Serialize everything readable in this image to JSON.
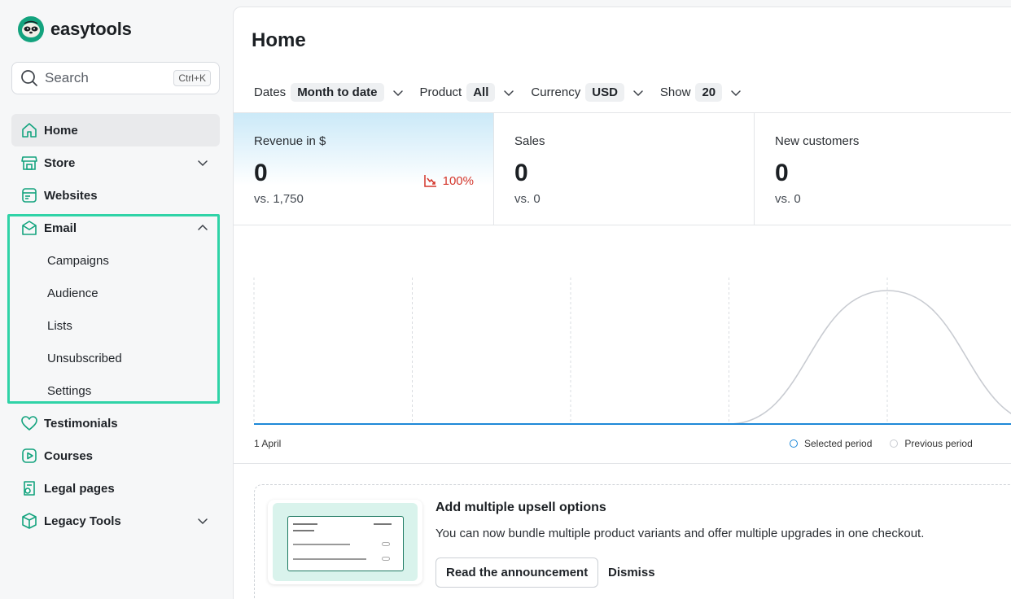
{
  "brand": {
    "name": "easytools",
    "accent": "#13a37e",
    "highlight": "#2fd3a7"
  },
  "search": {
    "placeholder": "Search",
    "shortcut": "Ctrl+K"
  },
  "sidebar": {
    "items": [
      {
        "label": "Home",
        "icon": "home-icon",
        "active": true
      },
      {
        "label": "Store",
        "icon": "store-icon",
        "chevron": "down"
      },
      {
        "label": "Websites",
        "icon": "websites-icon"
      },
      {
        "label": "Email",
        "icon": "email-icon",
        "chevron": "up",
        "expanded": true
      },
      {
        "label": "Testimonials",
        "icon": "heart-icon"
      },
      {
        "label": "Courses",
        "icon": "courses-icon"
      },
      {
        "label": "Legal pages",
        "icon": "legal-icon"
      },
      {
        "label": "Legacy Tools",
        "icon": "box-icon",
        "chevron": "down"
      }
    ],
    "email_subitems": [
      "Campaigns",
      "Audience",
      "Lists",
      "Unsubscribed",
      "Settings"
    ]
  },
  "page": {
    "title": "Home"
  },
  "filters": [
    {
      "label": "Dates",
      "value": "Month to date"
    },
    {
      "label": "Product",
      "value": "All"
    },
    {
      "label": "Currency",
      "value": "USD"
    },
    {
      "label": "Show",
      "value": "20"
    }
  ],
  "stats": [
    {
      "label": "Revenue in $",
      "value": "0",
      "previous": "vs. 1,750",
      "change": "100%",
      "change_color": "#d4362b"
    },
    {
      "label": "Sales",
      "value": "0",
      "previous": "vs. 0"
    },
    {
      "label": "New customers",
      "value": "0",
      "previous": "vs. 0"
    }
  ],
  "chart_data": {
    "type": "line",
    "x_start_label": "1 April",
    "series": [
      {
        "name": "Selected period",
        "color": "#1e88d8",
        "values": [
          0,
          0,
          0,
          0,
          0,
          0
        ]
      },
      {
        "name": "Previous period",
        "color": "#c8cbd1",
        "values": [
          0,
          0,
          0,
          0,
          1750,
          0
        ]
      }
    ],
    "grid": "vertical-dashed"
  },
  "announcement": {
    "title": "Add multiple upsell options",
    "text": "You can now bundle multiple product variants and offer multiple upgrades in one checkout.",
    "primary_button": "Read the announcement",
    "secondary_button": "Dismiss"
  }
}
